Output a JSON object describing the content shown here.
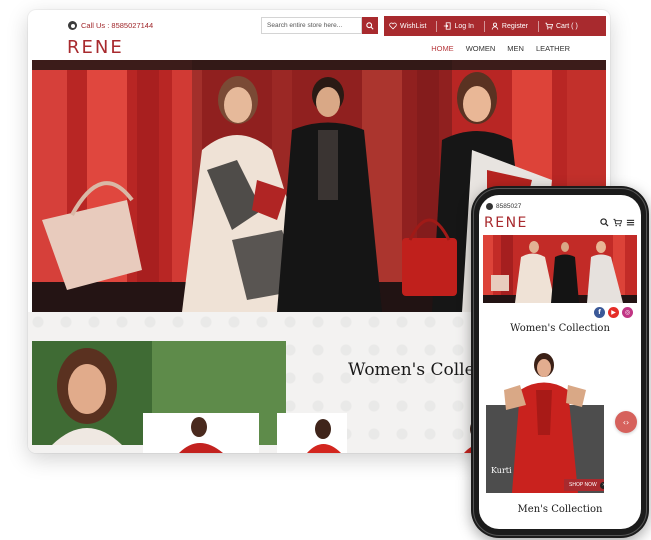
{
  "brand": {
    "name": "RENE",
    "accent": "#a82a2e"
  },
  "topbar": {
    "phone_label": "Call Us : 8585027144",
    "search_placeholder": "Search entire store here...",
    "actions": {
      "wishlist": "WishList",
      "login": "Log In",
      "register": "Register",
      "cart": "Cart ( )"
    }
  },
  "nav": {
    "items": [
      "HOME",
      "WOMEN",
      "MEN",
      "LEATHER"
    ],
    "active_index": 0
  },
  "sections": {
    "women": "Women's Collection",
    "men": "Men's Collection"
  },
  "mobile": {
    "phone_label": "8585027",
    "product_label": "Kurti",
    "shop_button": "SHOP NOW",
    "social": [
      "f",
      "▶",
      "◎"
    ]
  },
  "icons": [
    "whatsapp-icon",
    "search-icon",
    "heart-icon",
    "login-icon",
    "user-icon",
    "cart-icon",
    "hamburger-icon",
    "chevron-left-icon",
    "chevron-right-icon"
  ]
}
